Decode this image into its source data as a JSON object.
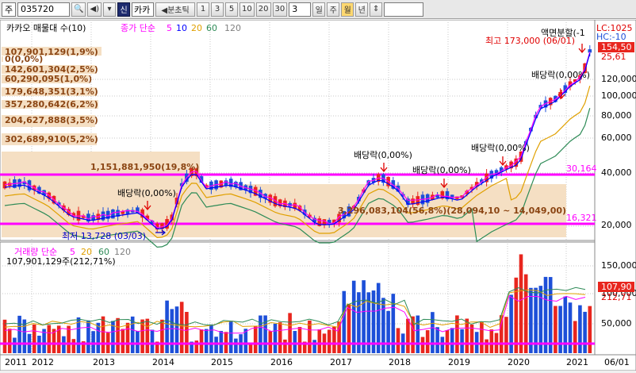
{
  "toolbar": {
    "market": "주",
    "code": "035720",
    "name_short": "카카",
    "mode_badge": "신",
    "prev_tick": "◀분초틱",
    "intervals": [
      "1",
      "3",
      "5",
      "10",
      "20",
      "30"
    ],
    "count": "3",
    "periods": [
      "일",
      "주",
      "월",
      "년"
    ],
    "selected_period": "월"
  },
  "legend": {
    "title": "카카오 매물대 수(10)",
    "ma_label": "종가 단순",
    "ma_periods": [
      "5",
      "10",
      "20",
      "60",
      "120"
    ],
    "ma_colors": [
      "#ff00ff",
      "#0000ff",
      "#e0a000",
      "#2e8b57",
      "#808080"
    ]
  },
  "volume_profile": [
    {
      "label": "107,901,129(1,9%)"
    },
    {
      "label": "0(0,0%)"
    },
    {
      "label": "142,601,304(2,5%)"
    },
    {
      "label": "60,290,095(1,0%)"
    },
    {
      "label": "179,648,351(3,1%)"
    },
    {
      "label": "357,280,642(6,2%)"
    },
    {
      "label": "204,627,888(3,5%)"
    },
    {
      "label": "302,689,910(5,2%)"
    },
    {
      "label": "1,151,881,950(19,8%)"
    },
    {
      "label": "3,296,083,104(56,8%)(28,094,10 ~ 14,049,00)"
    }
  ],
  "annotations": {
    "high": "최고 173,000 (06/01)",
    "low": "최저 13,728 (03/03)",
    "split": "액면분할(-1",
    "dividend": "배당락(0,00%)",
    "dividend2": "배당락(0,00%)",
    "dividend3": "배당락(0,00%)",
    "dividend4": "배당락(0,00%)",
    "dividend5": "배당락(0,00%)"
  },
  "price_axis": {
    "ticks": [
      "120,000",
      "100,000",
      "80,000",
      "60,000",
      "40,000",
      "20,000"
    ],
    "lc": "LC:1025",
    "hc": "HC:-10",
    "current": "154,50",
    "current2": "25,61",
    "line_upper": "30,164",
    "line_lower": "16,321"
  },
  "volume": {
    "legend": "거래량 단순",
    "ma_periods": [
      "5",
      "20",
      "60",
      "120"
    ],
    "ma_colors": [
      "#ff00ff",
      "#e0a000",
      "#2e8b57",
      "#808080"
    ],
    "value_label": "107,901,129주(212,71%)",
    "ticks": [
      "150,000",
      "100,000",
      "50,000"
    ],
    "current": "107,90",
    "current_pct": "212,71"
  },
  "x_axis": {
    "labels": [
      "2011",
      "2012",
      "2013",
      "2014",
      "2015",
      "2016",
      "2017",
      "2018",
      "2019",
      "2020",
      "2021",
      "06/01"
    ]
  },
  "colors": {
    "up": "#e8261e",
    "down": "#1d4fd8",
    "band": "#f5dfc3",
    "hline": "#ff00ff"
  }
}
